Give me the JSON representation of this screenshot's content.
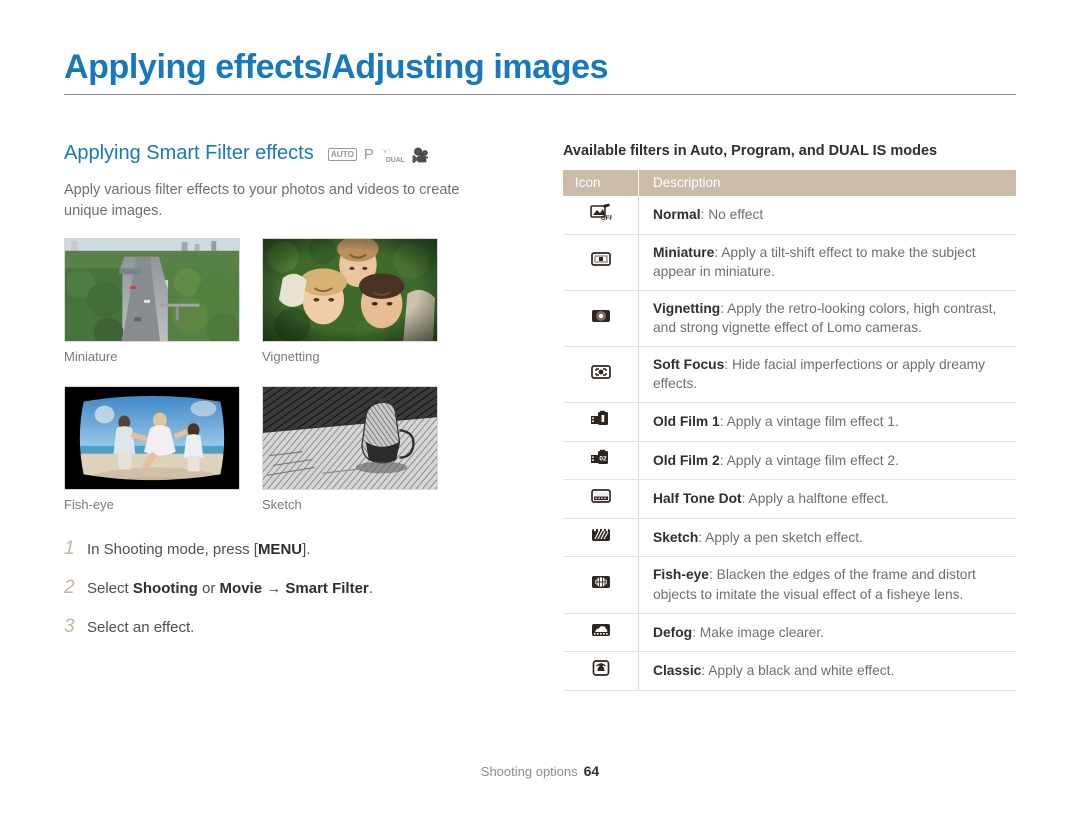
{
  "page_title": "Applying effects/Adjusting images",
  "section": {
    "title": "Applying Smart Filter effects",
    "mode_icons": [
      "AUTO",
      "P",
      "DUAL",
      "movie-camera"
    ],
    "mode_auto_label": "AUTO",
    "mode_p_label": "P",
    "mode_dual_label": "DUAL",
    "intro": "Apply various filter effects to your photos and videos to create unique images."
  },
  "samples": [
    {
      "caption": "Miniature",
      "image": "aerial-highway-tilt-shift"
    },
    {
      "caption": "Vignetting",
      "image": "three-people-on-grass"
    },
    {
      "caption": "Fish-eye",
      "image": "beach-family-fisheye"
    },
    {
      "caption": "Sketch",
      "image": "glass-pitcher-pencil-sketch"
    }
  ],
  "steps": [
    {
      "num": "1",
      "pre": "In Shooting mode, press [",
      "bold1": "MENU",
      "post": "]."
    },
    {
      "num": "2",
      "pre": "Select ",
      "bold1": "Shooting",
      "mid1": " or ",
      "bold2": "Movie",
      "arrow": " → ",
      "bold3": "Smart Filter",
      "post": "."
    },
    {
      "num": "3",
      "pre": "Select an effect.",
      "bold1": "",
      "post": ""
    }
  ],
  "table": {
    "caption": "Available filters in Auto, Program, and DUAL IS modes",
    "headers": {
      "icon": "Icon",
      "description": "Description"
    },
    "rows": [
      {
        "icon": "filter-off-icon",
        "name": "Normal",
        "desc": ": No effect"
      },
      {
        "icon": "miniature-icon",
        "name": "Miniature",
        "desc": ": Apply a tilt-shift effect to make the subject appear in miniature."
      },
      {
        "icon": "vignetting-icon",
        "name": "Vignetting",
        "desc": ": Apply the retro-looking colors, high contrast, and strong vignette effect of Lomo cameras."
      },
      {
        "icon": "soft-focus-icon",
        "name": "Soft Focus",
        "desc": ": Hide facial imperfections or apply dreamy effects."
      },
      {
        "icon": "old-film-1-icon",
        "name": "Old Film 1",
        "desc": ": Apply a vintage film effect 1."
      },
      {
        "icon": "old-film-2-icon",
        "name": "Old Film 2",
        "desc": ": Apply a vintage film effect 2."
      },
      {
        "icon": "half-tone-dot-icon",
        "name": "Half Tone Dot",
        "desc": ": Apply a halftone effect."
      },
      {
        "icon": "sketch-icon",
        "name": "Sketch",
        "desc": ": Apply a pen sketch effect."
      },
      {
        "icon": "fish-eye-icon",
        "name": "Fish-eye",
        "desc": ": Blacken the edges of the frame and distort objects to imitate the visual effect of a fisheye lens."
      },
      {
        "icon": "defog-icon",
        "name": "Defog",
        "desc": ": Make image clearer."
      },
      {
        "icon": "classic-icon",
        "name": "Classic",
        "desc": ": Apply a black and white effect."
      }
    ]
  },
  "footer": {
    "label": "Shooting options",
    "page_number": "64"
  },
  "colors": {
    "title_blue": "#1878bd",
    "table_header_tan": "#cbbca8",
    "step_number_tan": "#c4b49c",
    "body_gray": "#6f6f6f"
  }
}
